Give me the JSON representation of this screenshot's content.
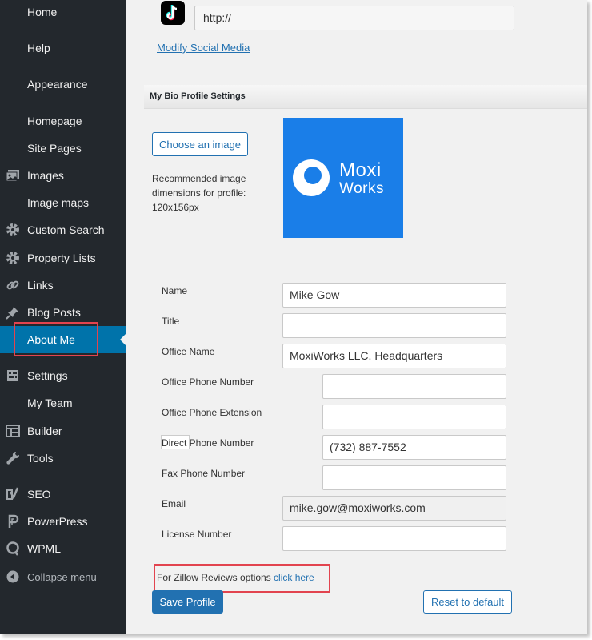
{
  "sidebar": {
    "items": [
      {
        "label": "Home",
        "icon": ""
      },
      {
        "label": "Help",
        "icon": ""
      },
      {
        "label": "Appearance",
        "icon": ""
      },
      {
        "label": "Homepage",
        "icon": ""
      },
      {
        "label": "Site Pages",
        "icon": ""
      },
      {
        "label": "Images",
        "icon": "images-icon"
      },
      {
        "label": "Image maps",
        "icon": ""
      },
      {
        "label": "Custom Search",
        "icon": "gear-icon"
      },
      {
        "label": "Property Lists",
        "icon": "gear-icon"
      },
      {
        "label": "Links",
        "icon": "link-icon"
      },
      {
        "label": "Blog Posts",
        "icon": "pin-icon"
      },
      {
        "label": "About Me",
        "icon": ""
      },
      {
        "label": "Settings",
        "icon": "settings-sliders-icon"
      },
      {
        "label": "My Team",
        "icon": ""
      },
      {
        "label": "Builder",
        "icon": "builder-grid-icon"
      },
      {
        "label": "Tools",
        "icon": "wrench-icon"
      },
      {
        "label": "SEO",
        "icon": "yoast-seo-icon"
      },
      {
        "label": "PowerPress",
        "icon": "powerpress-icon"
      },
      {
        "label": "WPML",
        "icon": "wpml-icon"
      },
      {
        "label": "Collapse menu",
        "icon": "collapse-arrow-icon"
      }
    ],
    "active": "About Me",
    "colors": {
      "background": "#23282d",
      "active": "#0073aa",
      "highlight": "#e2444f"
    }
  },
  "social": {
    "tiktok_url": "http://",
    "modify_link": "Modify Social Media"
  },
  "bio": {
    "section_title": "My Bio Profile Settings",
    "choose_image_button": "Choose an image",
    "recommendation": "Recommended image dimensions for profile: 120x156px",
    "logo": {
      "line1": "Moxi",
      "line2": "Works",
      "color": "#1a7ee8"
    }
  },
  "form": {
    "fields": [
      {
        "label": "Name",
        "value": "Mike Gow"
      },
      {
        "label": "Title",
        "value": ""
      },
      {
        "label": "Office Name",
        "value": "MoxiWorks LLC. Headquarters"
      },
      {
        "label": "Office Phone Number",
        "value": ""
      },
      {
        "label": "Office Phone Extension",
        "value": ""
      },
      {
        "label": "Direct Phone Number",
        "value": "(732) 887-7552"
      },
      {
        "label": "Fax Phone Number",
        "value": ""
      },
      {
        "label": "Email",
        "value": "mike.gow@moxiworks.com"
      },
      {
        "label": "License Number",
        "value": ""
      }
    ]
  },
  "zillow": {
    "text": "For Zillow Reviews options ",
    "link": "click here"
  },
  "actions": {
    "save": "Save Profile",
    "reset": "Reset to default"
  }
}
